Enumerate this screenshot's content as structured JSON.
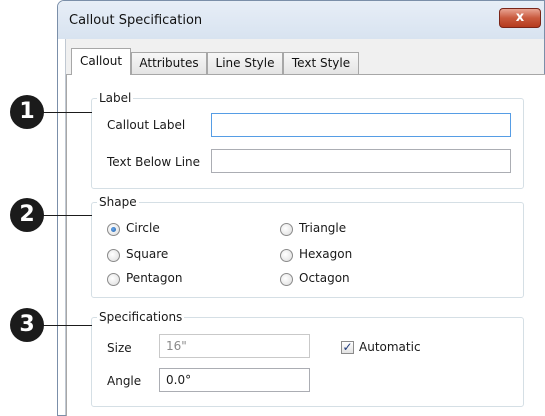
{
  "window": {
    "title": "Callout Specification",
    "close_glyph": "x"
  },
  "tabs": [
    {
      "label": "Callout",
      "active": true
    },
    {
      "label": "Attributes",
      "active": false
    },
    {
      "label": "Line Style",
      "active": false
    },
    {
      "label": "Text Style",
      "active": false
    }
  ],
  "label_group": {
    "legend": "Label",
    "callout_label": {
      "label": "Callout Label",
      "value": ""
    },
    "text_below_line": {
      "label": "Text Below Line",
      "value": ""
    }
  },
  "shape_group": {
    "legend": "Shape",
    "options": [
      {
        "label": "Circle",
        "checked": true
      },
      {
        "label": "Triangle",
        "checked": false
      },
      {
        "label": "Square",
        "checked": false
      },
      {
        "label": "Hexagon",
        "checked": false
      },
      {
        "label": "Pentagon",
        "checked": false
      },
      {
        "label": "Octagon",
        "checked": false
      }
    ]
  },
  "spec_group": {
    "legend": "Specifications",
    "size": {
      "label": "Size",
      "value": "16\""
    },
    "automatic": {
      "label": "Automatic",
      "checked": true
    },
    "angle": {
      "label": "Angle",
      "value": "0.0°"
    }
  },
  "markers": [
    "1",
    "2",
    "3"
  ],
  "colors": {
    "close_button": "#c95a3e",
    "radio_selected": "#1d5fa8",
    "input_focus_border": "#569de5",
    "group_border": "#d5dfe5"
  }
}
